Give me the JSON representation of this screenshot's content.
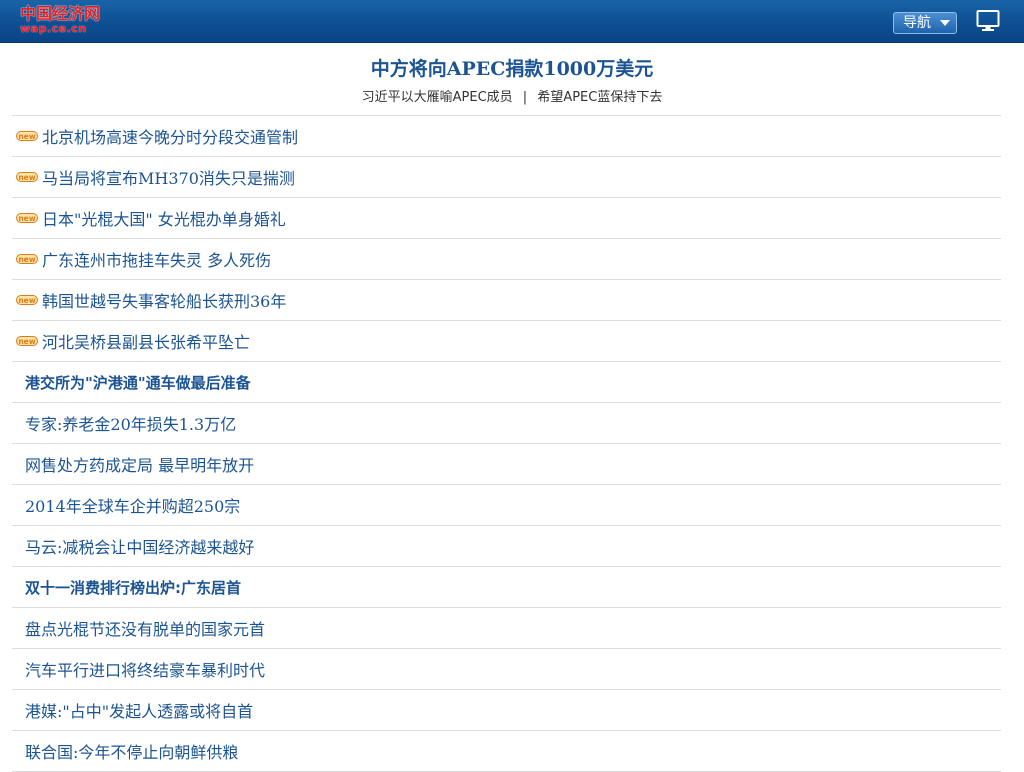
{
  "header": {
    "logo_text": "中国经济网",
    "logo_url": "wap.ce.cn",
    "nav_label": "导航"
  },
  "headline": {
    "title": "中方将向APEC捐款1000万美元",
    "sub_links": [
      "习近平以大雁喻APEC成员",
      "希望APEC蓝保持下去"
    ],
    "separator": "|"
  },
  "news_new": [
    "北京机场高速今晚分时分段交通管制",
    "马当局将宣布MH370消失只是揣测",
    "日本\"光棍大国\" 女光棍办单身婚礼",
    "广东连州市拖挂车失灵 多人死伤",
    "韩国世越号失事客轮船长获刑36年",
    "河北吴桥县副县长张希平坠亡"
  ],
  "news_plain": [
    "港交所为\"沪港通\"通车做最后准备",
    "专家:养老金20年损失1.3万亿",
    "网售处方药成定局 最早明年放开",
    "2014年全球车企并购超250宗",
    "马云:减税会让中国经济越来越好",
    "双十一消费排行榜出炉:广东居首",
    "盘点光棍节还没有脱单的国家元首",
    "汽车平行进口将终结豪车暴利时代",
    "港媒:\"占中\"发起人透露或将自首",
    "联合国:今年不停止向朝鲜供粮"
  ],
  "colors": {
    "header_bg": "#0d4f92",
    "link": "#1c5493",
    "logo_red": "#d8232a",
    "divider": "#dcdcdc"
  },
  "icons": {
    "new_badge": "new-badge-icon",
    "nav_caret": "caret-down-icon",
    "desktop": "desktop-monitor-icon"
  }
}
